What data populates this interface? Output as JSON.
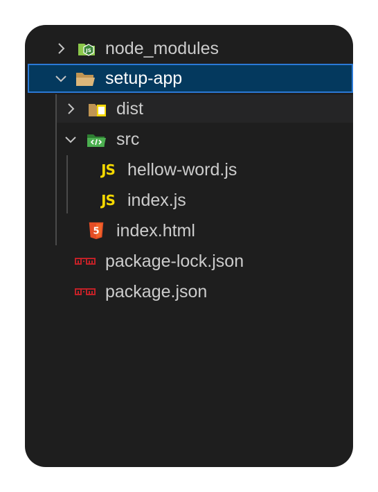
{
  "explorer": {
    "items": [
      {
        "label": "node_modules",
        "icon": "nodejs-folder-icon",
        "expanded": false
      },
      {
        "label": "setup-app",
        "icon": "open-folder-icon",
        "expanded": true,
        "selected": true
      },
      {
        "label": "dist",
        "icon": "dist-folder-icon",
        "expanded": false
      },
      {
        "label": "src",
        "icon": "src-folder-icon",
        "expanded": true
      },
      {
        "label": "hellow-word.js",
        "icon": "javascript-file-icon",
        "icon_text": "JS"
      },
      {
        "label": "index.js",
        "icon": "javascript-file-icon",
        "icon_text": "JS"
      },
      {
        "label": "index.html",
        "icon": "html5-file-icon"
      },
      {
        "label": "package-lock.json",
        "icon": "npm-file-icon"
      },
      {
        "label": "package.json",
        "icon": "npm-file-icon"
      }
    ]
  },
  "colors": {
    "background": "#1e1e1e",
    "selected_bg": "#04395e",
    "selected_border": "#2b79d6",
    "text": "#cccccc",
    "js_yellow": "#f5d800",
    "html_orange": "#e44d26",
    "npm_red": "#c12127",
    "folder_tan": "#dcb67a",
    "node_green": "#8cc84b"
  }
}
